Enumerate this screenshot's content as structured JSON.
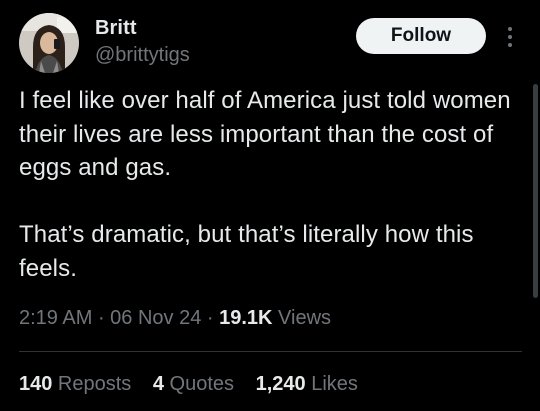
{
  "author": {
    "name": "Britt",
    "handle": "@brittytigs",
    "avatar_icon": "profile-photo"
  },
  "follow_button": {
    "label": "Follow"
  },
  "more_icon": "more-vertical-icon",
  "tweet": {
    "paragraph_1": "I feel like over half of America just told women their lives are less important than the cost of eggs and gas.",
    "paragraph_2": "That’s dramatic, but that’s literally how this feels."
  },
  "meta": {
    "time": "2:19 AM",
    "separator_1": " · ",
    "date": "06 Nov 24",
    "separator_2": " · ",
    "views_count": "19.1K",
    "views_label": " Views"
  },
  "stats": {
    "reposts_count": "140",
    "reposts_label": " Reposts",
    "quotes_count": "4",
    "quotes_label": " Quotes",
    "likes_count": "1,240",
    "likes_label": " Likes"
  },
  "colors": {
    "background": "#000000",
    "primary_text": "#e7e9ea",
    "secondary_text": "#71767b",
    "follow_bg": "#eff3f4",
    "follow_text": "#0f1419",
    "divider": "#2f3336"
  }
}
